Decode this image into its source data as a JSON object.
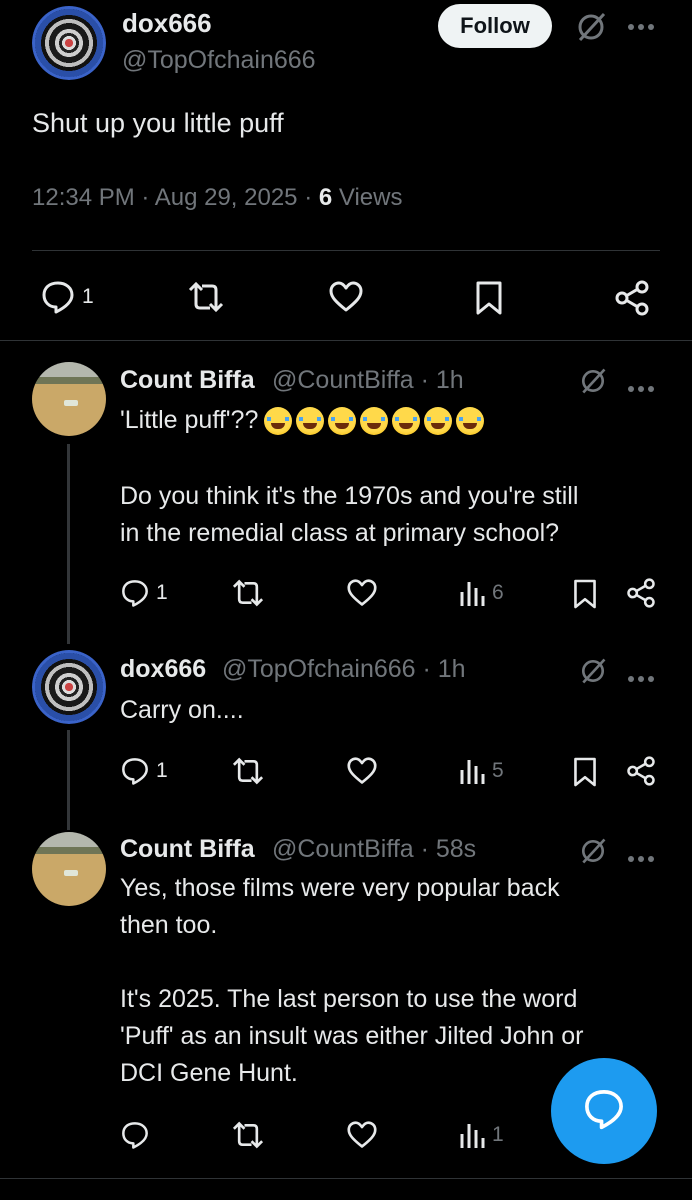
{
  "main_post": {
    "display_name": "dox666",
    "handle": "@TopOfchain666",
    "follow_label": "Follow",
    "text": "Shut up you little puff",
    "time": "12:34 PM · Aug 29, 2025 · ",
    "views_count": "6",
    "views_label": " Views",
    "reply_count": "1"
  },
  "replies": [
    {
      "display_name": "Count Biffa",
      "meta": "@CountBiffa · 1h",
      "text_line1": "'Little puff'??",
      "text_rest": "Do you think it's the 1970s and you're still\nin the remedial class at primary school?",
      "reply_count": "1",
      "views": "6",
      "emoji_count": "7"
    },
    {
      "display_name": "dox666",
      "meta": "@TopOfchain666 · 1h",
      "text": "Carry on....",
      "reply_count": "1",
      "views": "5"
    },
    {
      "display_name": "Count Biffa",
      "meta": "@CountBiffa · 58s",
      "text": "Yes, those films were very popular back\nthen too.\n\nIt's 2025. The last person to use the word\n'Puff' as an insult was either Jilted John or\nDCI Gene Hunt.",
      "reply_count": "",
      "views": "1"
    }
  ],
  "colors": {
    "background": "#000000",
    "text": "#e7e9ea",
    "muted": "#71767b",
    "accent": "#1d9bf0",
    "divider": "#2f3336"
  },
  "icons": [
    "reply-icon",
    "retweet-icon",
    "like-icon",
    "bookmark-icon",
    "share-icon",
    "views-icon",
    "grok-icon",
    "more-icon",
    "compose-reply-icon"
  ]
}
